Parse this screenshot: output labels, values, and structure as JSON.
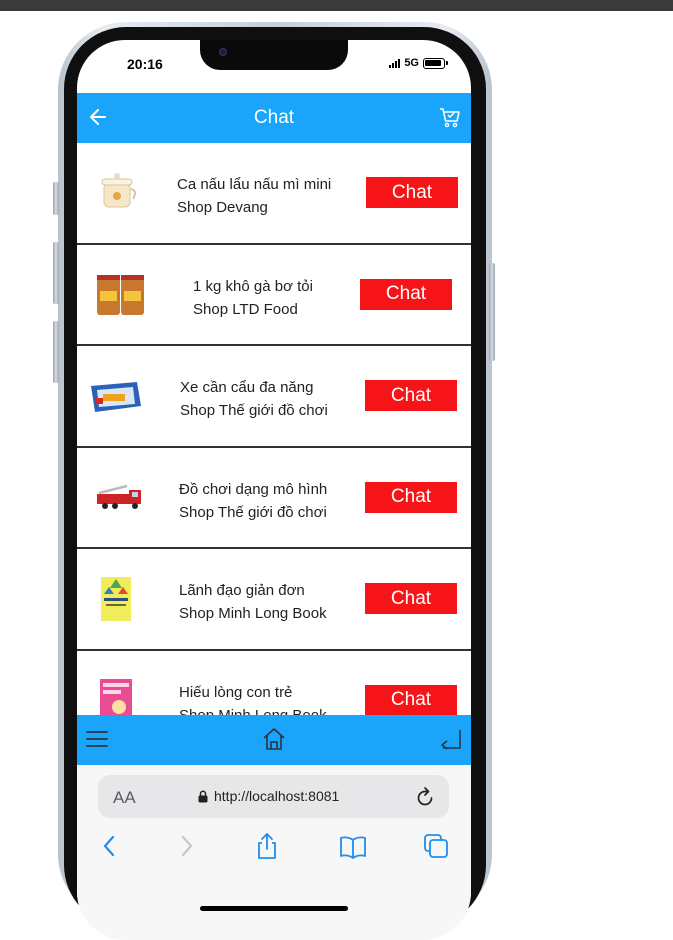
{
  "status_bar": {
    "time": "20:16",
    "network": "5G"
  },
  "header": {
    "title": "Chat",
    "back_icon": "arrow-left-icon",
    "cart_icon": "cart-icon"
  },
  "chat_list": [
    {
      "product": "Ca nấu lẩu nấu mì mini",
      "shop": "Shop Devang",
      "button": "Chat",
      "thumb": "kettle-image"
    },
    {
      "product": "1 kg khô gà bơ tỏi",
      "shop": "Shop LTD Food",
      "button": "Chat",
      "thumb": "jars-image"
    },
    {
      "product": "Xe cần cẩu đa năng",
      "shop": "Shop Thế giới đồ chơi",
      "button": "Chat",
      "thumb": "toy-box-image"
    },
    {
      "product": "Đồ chơi dạng mô hình",
      "shop": "Shop Thế giới đồ chơi",
      "button": "Chat",
      "thumb": "fire-truck-image"
    },
    {
      "product": "Lãnh đạo giản đơn",
      "shop": "Shop Minh Long Book",
      "button": "Chat",
      "thumb": "book-yellow-image"
    },
    {
      "product": "Hiếu lòng con trẻ",
      "shop": "Shop Minh Long Book",
      "button": "Chat",
      "thumb": "book-pink-image"
    }
  ],
  "bottom_nav": {
    "menu_icon": "menu-icon",
    "home_icon": "home-icon",
    "return_icon": "return-icon"
  },
  "browser": {
    "text_size_label": "AA",
    "url": "http://localhost:8081",
    "toolbar_icons": [
      "back-icon",
      "forward-icon",
      "share-icon",
      "bookmarks-icon",
      "tabs-icon"
    ]
  },
  "colors": {
    "accent": "#1aa5fb",
    "chat_button": "#f71419",
    "divider": "#2e3236"
  }
}
